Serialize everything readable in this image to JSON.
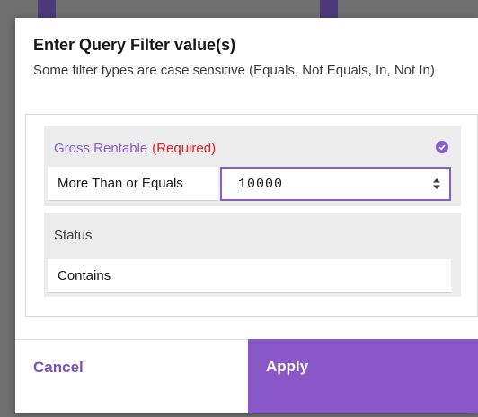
{
  "dialog": {
    "title": "Enter Query Filter value(s)",
    "subtitle": "Some filter types are case sensitive (Equals, Not Equals, In, Not In)"
  },
  "filters": {
    "gross": {
      "label": "Gross Rentable",
      "required": "(Required)",
      "operator": "More Than or Equals",
      "value": "10000"
    },
    "status": {
      "label": "Status",
      "operator": "Contains"
    }
  },
  "footer": {
    "cancel_label": "Cancel",
    "apply_label": "Apply"
  },
  "colors": {
    "accent": "#8a57c8",
    "required": "#da1e28"
  },
  "icons": {
    "valid": "checkmark-circle-icon",
    "stepper": "up-down-stepper-icon"
  }
}
